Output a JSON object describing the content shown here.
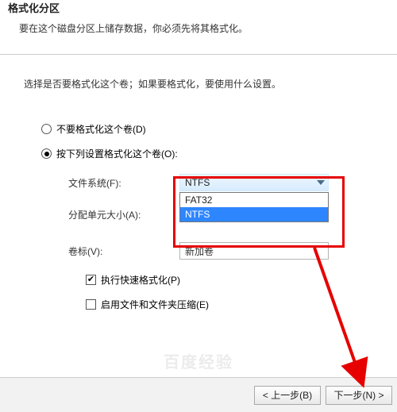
{
  "header": {
    "title": "格式化分区",
    "subtitle": "要在这个磁盘分区上储存数据，你必须先将其格式化。"
  },
  "instruction": "选择是否要格式化这个卷；如果要格式化，要使用什么设置。",
  "radios": {
    "no_format": "不要格式化这个卷(D)",
    "format_with": "按下列设置格式化这个卷(O):"
  },
  "fields": {
    "filesystem_label": "文件系统(F):",
    "filesystem_value": "NTFS",
    "filesystem_options": [
      "FAT32",
      "NTFS"
    ],
    "alloc_label": "分配单元大小(A):",
    "alloc_value": "",
    "volume_label_label": "卷标(V):",
    "volume_label_value": "新加卷"
  },
  "checks": {
    "quick_format": "执行快速格式化(P)",
    "compress": "启用文件和文件夹压缩(E)"
  },
  "footer": {
    "back": "< 上一步(B)",
    "next": "下一步(N) >"
  },
  "watermark": "百度经验"
}
